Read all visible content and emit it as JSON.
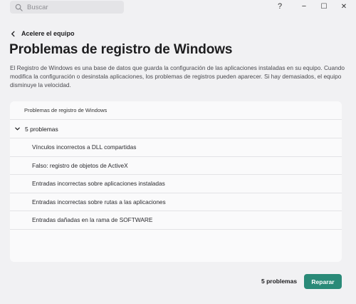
{
  "search": {
    "placeholder": "Buscar"
  },
  "window_controls": {
    "help": "?",
    "minimize": "−",
    "maximize": "☐",
    "close": "✕"
  },
  "back_link": "Acelere el equipo",
  "page_title": "Problemas de registro de Windows",
  "description": "El Registro de Windows es una base de datos que guarda la configuración de las aplicaciones instaladas en su equipo. Cuando modifica la configuración o desinstala aplicaciones, los problemas de registros pueden aparecer. Si hay demasiados, el equipo disminuye la velocidad.",
  "panel": {
    "header": "Problemas de registro de Windows",
    "group_label": "5 problemas",
    "items": [
      {
        "label": "Vínculos incorrectos a DLL compartidas"
      },
      {
        "label": "Falso: registro de objetos de ActiveX"
      },
      {
        "label": "Entradas incorrectas sobre aplicaciones instaladas"
      },
      {
        "label": "Entradas incorrectas sobre rutas a las aplicaciones"
      },
      {
        "label": "Entradas dañadas en la rama de SOFTWARE"
      }
    ]
  },
  "footer": {
    "count": "5 problemas",
    "repair_button": "Reparar"
  },
  "colors": {
    "accent": "#2a8a78",
    "background": "#f1f1f3",
    "panel": "#fafafb"
  }
}
